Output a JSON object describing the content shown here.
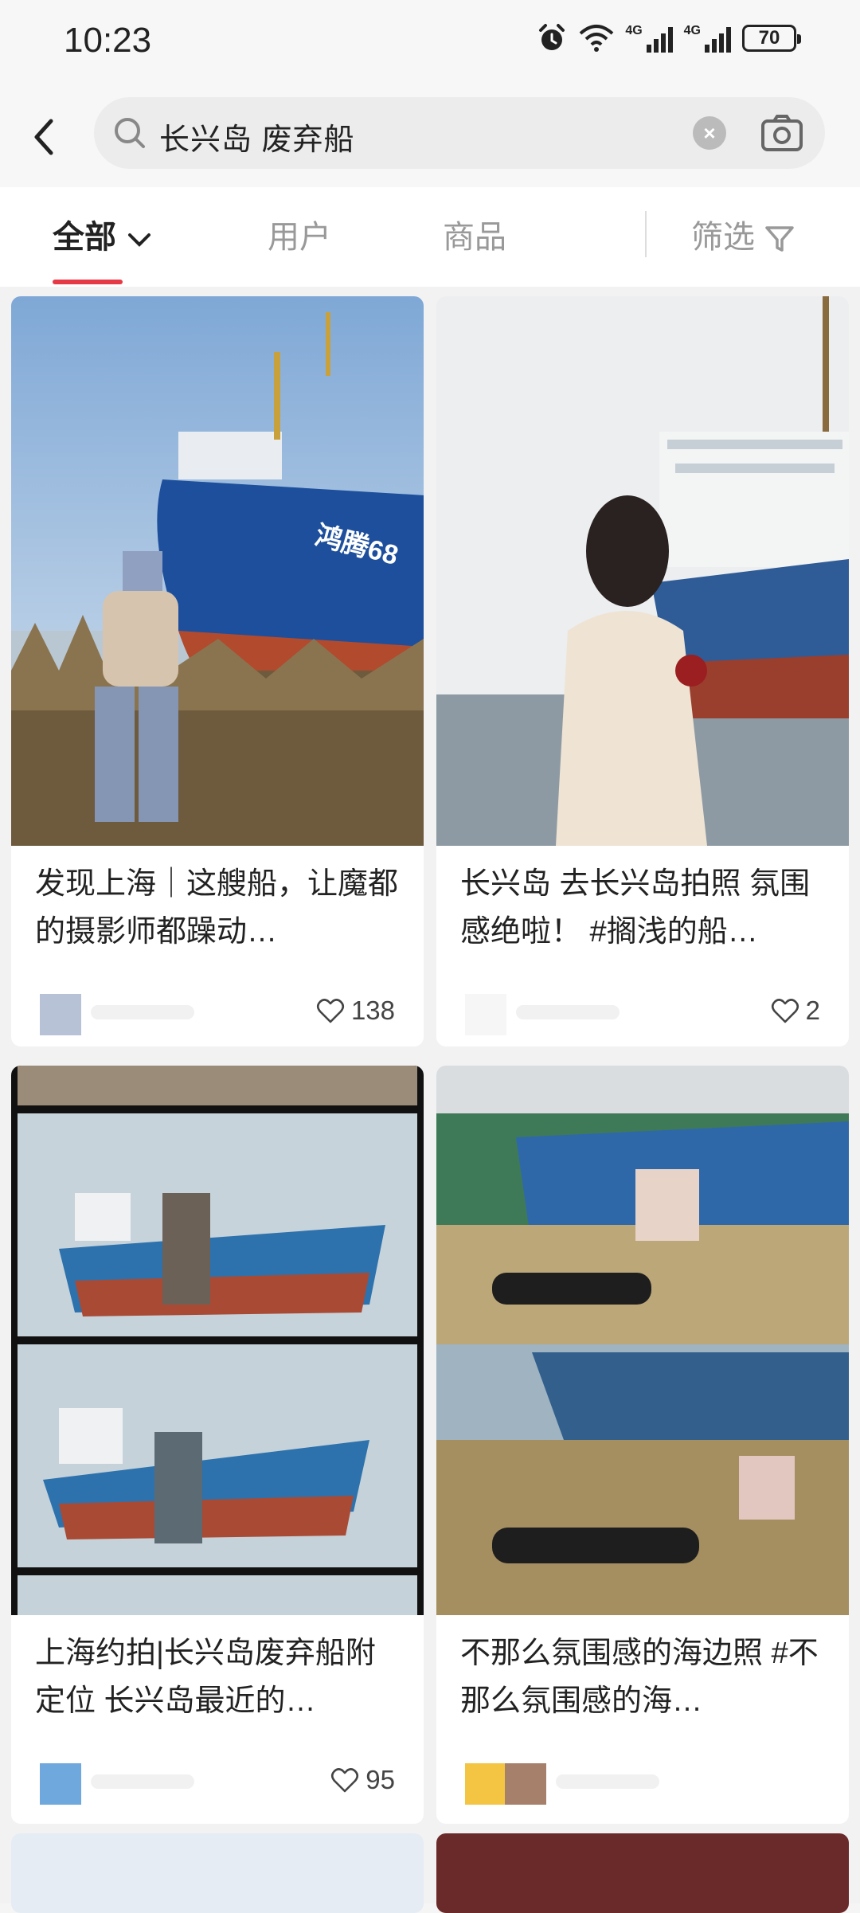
{
  "status_bar": {
    "time": "10:23",
    "network_1": "4G",
    "network_2": "4G",
    "battery": "70",
    "icons": [
      "alarm-icon",
      "wifi-icon",
      "signal-icon",
      "signal-icon",
      "battery-icon"
    ]
  },
  "search": {
    "query": "长兴岛 废弃船",
    "clear_label": "×"
  },
  "tabs": {
    "all": "全部",
    "users": "用户",
    "products": "商品",
    "filter": "筛选"
  },
  "colors": {
    "accent": "#e63946",
    "background": "#f2f2f2",
    "card": "#ffffff"
  },
  "posts": [
    {
      "title": "发现上海｜这艘船，让魔都的摄影师都躁动…",
      "likes": "138",
      "image": "abandoned blue and red cargo ship on grassy shore with person standing"
    },
    {
      "title": "长兴岛 去长兴岛拍照 氛围感绝啦！ #搁浅的船…",
      "likes": "2",
      "image": "woman in white dress facing a stranded ship on water"
    },
    {
      "title": "上海约拍|长兴岛废弃船附定位 长兴岛最近的…",
      "likes": "95",
      "image": "collage of stranded ship photos with person"
    },
    {
      "title": "不那么氛围感的海边照 #不那么氛围感的海…",
      "likes": "",
      "image": "person sitting on chair in dry grass before stranded ship"
    }
  ]
}
